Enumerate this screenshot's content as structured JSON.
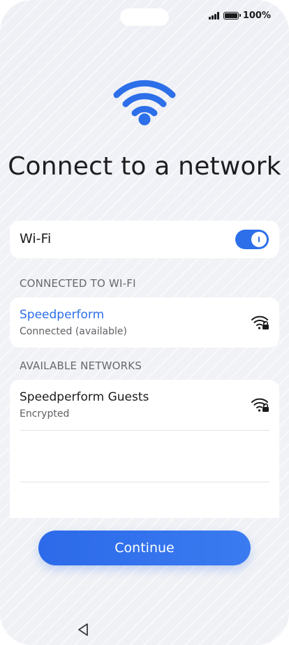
{
  "status_bar": {
    "battery_text": "100%",
    "battery_level": 1.0,
    "signal_icon": "cellular-signal-icon",
    "battery_icon": "battery-icon"
  },
  "header": {
    "icon": "wifi-icon",
    "title": "Connect to a network"
  },
  "wifi_toggle": {
    "label": "Wi-Fi",
    "enabled": true
  },
  "connected_section": {
    "heading": "CONNECTED TO WI-FI",
    "network": {
      "name": "Speedperform",
      "status": "Connected (available)",
      "icon": "wifi-locked-icon"
    }
  },
  "available_section": {
    "heading": "AVAILABLE NETWORKS",
    "networks": [
      {
        "name": "Speedperform Guests",
        "security": "Encrypted",
        "icon": "wifi-locked-icon"
      }
    ]
  },
  "actions": {
    "continue_label": "Continue"
  },
  "nav_bar": {
    "back_icon": "back-triangle-icon"
  },
  "colors": {
    "accent": "#2d6fe9",
    "background": "#eef0f5",
    "card": "#ffffff"
  }
}
